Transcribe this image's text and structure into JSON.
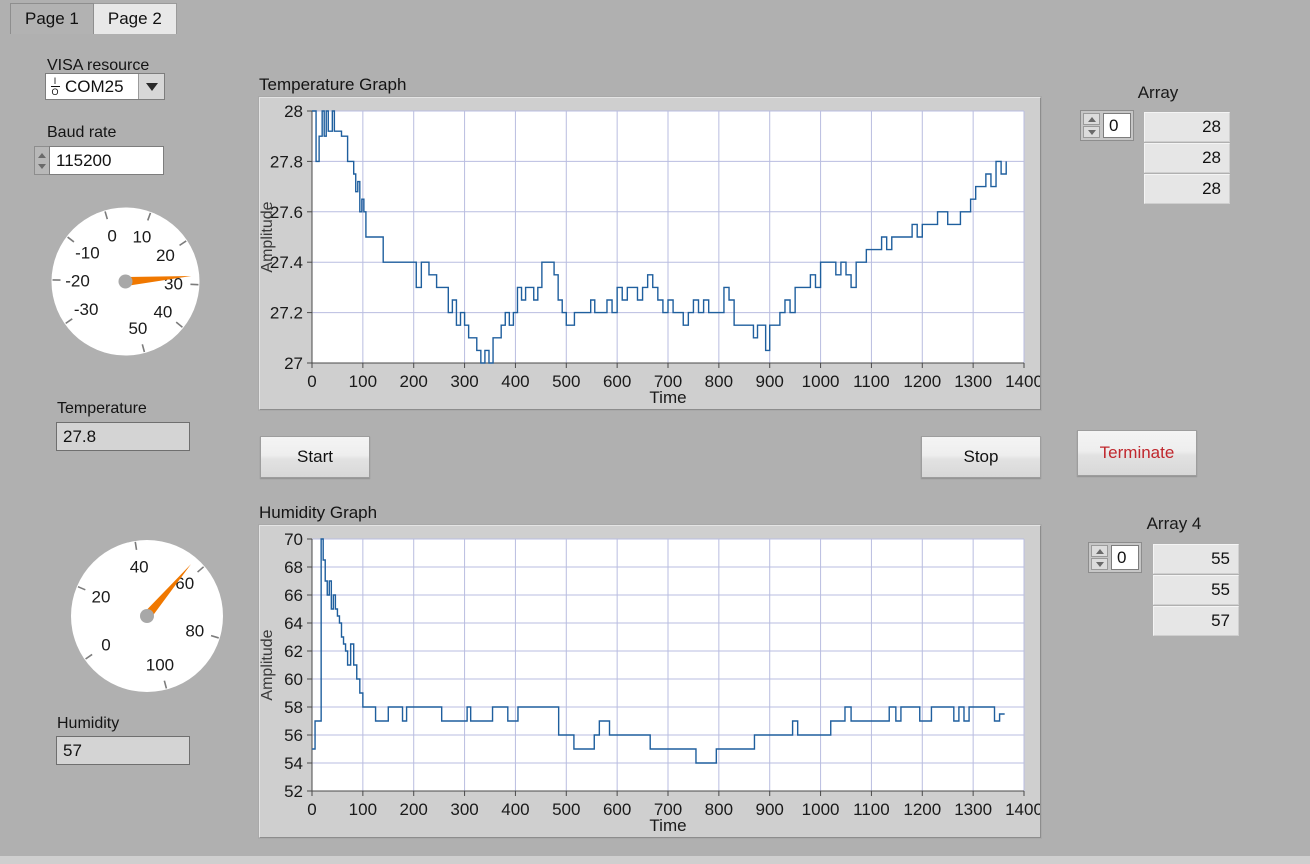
{
  "window": {
    "background_color": "#b0b0b0"
  },
  "tabs": [
    {
      "label": "Page 1",
      "active": true
    },
    {
      "label": "Page 2",
      "active": false
    }
  ],
  "controls": {
    "visa": {
      "label": "VISA resource",
      "value": "COM25",
      "glyph": "io-glyph",
      "dropdown_icon": "chevron-down-icon"
    },
    "baud": {
      "label": "Baud rate",
      "value": "115200"
    },
    "temperature_indicator": {
      "label": "Temperature",
      "value": "27.8"
    },
    "humidity_indicator": {
      "label": "Humidity",
      "value": "57"
    }
  },
  "gauges": {
    "temperature": {
      "name": "temperature-gauge",
      "min": -30,
      "max": 50,
      "value": 28,
      "ticks": [
        -30,
        -20,
        -10,
        0,
        10,
        20,
        30,
        40,
        50
      ],
      "needle_color": "#f07800",
      "face_color": "#ffffff"
    },
    "humidity": {
      "name": "humidity-gauge",
      "min": 0,
      "max": 100,
      "value": 57,
      "ticks": [
        0,
        20,
        40,
        60,
        80,
        100
      ],
      "needle_color": "#f07800",
      "face_color": "#ffffff"
    }
  },
  "buttons": {
    "start": {
      "label": "Start",
      "color": "#111111"
    },
    "stop": {
      "label": "Stop",
      "color": "#111111"
    },
    "terminate": {
      "label": "Terminate",
      "color": "#c0272d"
    }
  },
  "arrays": {
    "temperature_array": {
      "title": "Array",
      "index": "0",
      "cells": [
        "28",
        "28",
        "28"
      ]
    },
    "humidity_array": {
      "title": "Array 4",
      "index": "0",
      "cells": [
        "55",
        "55",
        "57"
      ]
    }
  },
  "chart_data": [
    {
      "name": "temperature-graph",
      "type": "line",
      "title": "Temperature Graph",
      "xlabel": "Time",
      "ylabel": "Amplitude",
      "xlim": [
        0,
        1400
      ],
      "ylim": [
        27,
        28
      ],
      "xticks": [
        0,
        100,
        200,
        300,
        400,
        500,
        600,
        700,
        800,
        900,
        1000,
        1100,
        1200,
        1300,
        1400
      ],
      "yticks": [
        27,
        27.2,
        27.4,
        27.6,
        27.8,
        28
      ],
      "grid": true,
      "legend": null,
      "line_color": "#1f5f9e",
      "series": [
        {
          "name": "Temperature",
          "x": [
            0,
            8,
            14,
            20,
            24,
            28,
            32,
            36,
            40,
            44,
            48,
            52,
            58,
            64,
            70,
            76,
            82,
            86,
            90,
            94,
            98,
            102,
            106,
            112,
            118,
            124,
            132,
            140,
            150,
            165,
            180,
            195,
            205,
            215,
            222,
            230,
            238,
            245,
            252,
            260,
            268,
            276,
            284,
            292,
            300,
            308,
            316,
            324,
            332,
            340,
            348,
            356,
            364,
            372,
            380,
            388,
            396,
            404,
            412,
            420,
            428,
            436,
            444,
            452,
            460,
            468,
            476,
            484,
            492,
            500,
            508,
            516,
            524,
            532,
            540,
            548,
            556,
            564,
            572,
            580,
            590,
            600,
            610,
            620,
            630,
            640,
            650,
            660,
            670,
            680,
            690,
            700,
            710,
            720,
            730,
            740,
            750,
            760,
            770,
            780,
            790,
            800,
            810,
            820,
            830,
            840,
            850,
            860,
            868,
            876,
            884,
            892,
            900,
            910,
            920,
            930,
            940,
            950,
            960,
            970,
            980,
            990,
            1000,
            1010,
            1020,
            1030,
            1040,
            1050,
            1060,
            1070,
            1080,
            1090,
            1100,
            1110,
            1120,
            1130,
            1140,
            1150,
            1160,
            1170,
            1180,
            1190,
            1200,
            1210,
            1230,
            1250,
            1265,
            1275,
            1285,
            1295,
            1305,
            1315,
            1325,
            1335,
            1345,
            1355,
            1365
          ],
          "y": [
            28.0,
            27.8,
            27.9,
            28.0,
            27.9,
            28.0,
            27.92,
            27.92,
            28.0,
            27.92,
            27.92,
            27.92,
            27.9,
            27.9,
            27.8,
            27.8,
            27.75,
            27.68,
            27.72,
            27.6,
            27.65,
            27.6,
            27.5,
            27.5,
            27.5,
            27.5,
            27.5,
            27.4,
            27.4,
            27.4,
            27.4,
            27.4,
            27.3,
            27.4,
            27.4,
            27.35,
            27.35,
            27.3,
            27.3,
            27.3,
            27.2,
            27.25,
            27.15,
            27.2,
            27.15,
            27.1,
            27.1,
            27.05,
            27.0,
            27.05,
            27.0,
            27.1,
            27.1,
            27.15,
            27.2,
            27.15,
            27.2,
            27.3,
            27.25,
            27.3,
            27.3,
            27.25,
            27.3,
            27.4,
            27.4,
            27.4,
            27.35,
            27.25,
            27.2,
            27.15,
            27.15,
            27.2,
            27.2,
            27.2,
            27.2,
            27.25,
            27.2,
            27.2,
            27.2,
            27.25,
            27.2,
            27.3,
            27.25,
            27.3,
            27.3,
            27.25,
            27.3,
            27.35,
            27.3,
            27.25,
            27.2,
            27.25,
            27.2,
            27.2,
            27.15,
            27.2,
            27.25,
            27.2,
            27.25,
            27.2,
            27.2,
            27.2,
            27.3,
            27.25,
            27.15,
            27.15,
            27.15,
            27.15,
            27.1,
            27.15,
            27.15,
            27.05,
            27.15,
            27.15,
            27.2,
            27.25,
            27.2,
            27.3,
            27.3,
            27.3,
            27.35,
            27.3,
            27.4,
            27.4,
            27.4,
            27.35,
            27.4,
            27.35,
            27.3,
            27.4,
            27.4,
            27.45,
            27.45,
            27.45,
            27.5,
            27.45,
            27.5,
            27.5,
            27.5,
            27.5,
            27.55,
            27.5,
            27.55,
            27.55,
            27.6,
            27.55,
            27.55,
            27.6,
            27.6,
            27.65,
            27.7,
            27.7,
            27.75,
            27.7,
            27.8,
            27.75,
            27.8,
            27.75,
            27.8
          ]
        }
      ]
    },
    {
      "name": "humidity-graph",
      "type": "line",
      "title": "Humidity Graph",
      "xlabel": "Time",
      "ylabel": "Amplitude",
      "xlim": [
        0,
        1400
      ],
      "ylim": [
        52,
        70
      ],
      "xticks": [
        0,
        100,
        200,
        300,
        400,
        500,
        600,
        700,
        800,
        900,
        1000,
        1100,
        1200,
        1300,
        1400
      ],
      "yticks": [
        52,
        54,
        56,
        58,
        60,
        62,
        64,
        66,
        68,
        70
      ],
      "grid": true,
      "legend": null,
      "line_color": "#1f5f9e",
      "series": [
        {
          "name": "Humidity",
          "x": [
            0,
            6,
            12,
            18,
            22,
            26,
            30,
            34,
            38,
            42,
            46,
            50,
            54,
            58,
            62,
            66,
            70,
            76,
            82,
            88,
            94,
            100,
            110,
            125,
            140,
            150,
            160,
            170,
            178,
            186,
            195,
            205,
            220,
            235,
            248,
            255,
            265,
            280,
            295,
            305,
            312,
            318,
            325,
            340,
            355,
            370,
            385,
            395,
            405,
            420,
            440,
            460,
            475,
            485,
            500,
            515,
            530,
            545,
            555,
            565,
            575,
            585,
            595,
            610,
            625,
            640,
            655,
            665,
            680,
            700,
            720,
            740,
            755,
            765,
            780,
            795,
            805,
            820,
            840,
            855,
            870,
            890,
            910,
            930,
            945,
            955,
            965,
            975,
            990,
            1005,
            1020,
            1035,
            1048,
            1060,
            1075,
            1090,
            1105,
            1120,
            1135,
            1148,
            1158,
            1168,
            1180,
            1195,
            1208,
            1218,
            1235,
            1250,
            1262,
            1272,
            1282,
            1292,
            1302,
            1312,
            1322,
            1332,
            1342,
            1352,
            1362,
            1370
          ],
          "y": [
            55,
            57,
            57,
            70,
            68.5,
            67,
            66,
            67,
            65,
            66,
            65,
            64.5,
            64,
            63,
            62.5,
            62,
            61,
            62.5,
            61,
            60,
            59,
            58,
            58,
            57,
            57,
            58,
            58,
            58,
            57,
            58,
            58,
            58,
            58,
            58,
            58,
            57,
            57,
            57,
            57,
            58,
            57,
            57,
            57,
            57,
            58,
            58,
            57,
            57,
            58,
            58,
            58,
            58,
            58,
            56,
            56,
            55,
            55,
            55,
            56,
            57,
            57,
            56,
            56,
            56,
            56,
            56,
            56,
            55,
            55,
            55,
            55,
            55,
            54,
            54,
            54,
            55,
            55,
            55,
            55,
            55,
            56,
            56,
            56,
            56,
            57,
            56,
            56,
            56,
            56,
            56,
            57,
            57,
            58,
            57,
            57,
            57,
            57,
            57,
            58,
            57,
            58,
            58,
            58,
            57,
            57,
            58,
            58,
            58,
            57,
            58,
            57,
            58,
            58,
            58,
            58,
            58,
            57,
            57.5
          ]
        }
      ]
    }
  ]
}
